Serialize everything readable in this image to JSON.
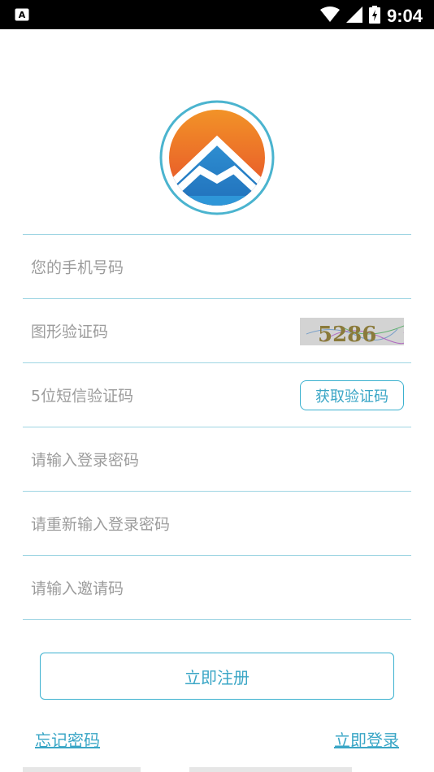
{
  "status_bar": {
    "time": "9:04",
    "icons": [
      "notification-a-icon",
      "wifi-icon",
      "signal-icon",
      "battery-charging-icon"
    ]
  },
  "app": {
    "logo": "mountain-logo-icon",
    "accent_color": "#3cb1cf"
  },
  "form": {
    "phone_placeholder": "您的手机号码",
    "captcha_placeholder": "图形验证码",
    "captcha_image_text": "5286",
    "sms_placeholder": "5位短信验证码",
    "sms_button": "获取验证码",
    "password_placeholder": "请输入登录密码",
    "password_confirm_placeholder": "请重新输入登录密码",
    "invite_placeholder": "请输入邀请码"
  },
  "actions": {
    "register": "立即注册",
    "forgot_password": "忘记密码",
    "login": "立即登录"
  }
}
